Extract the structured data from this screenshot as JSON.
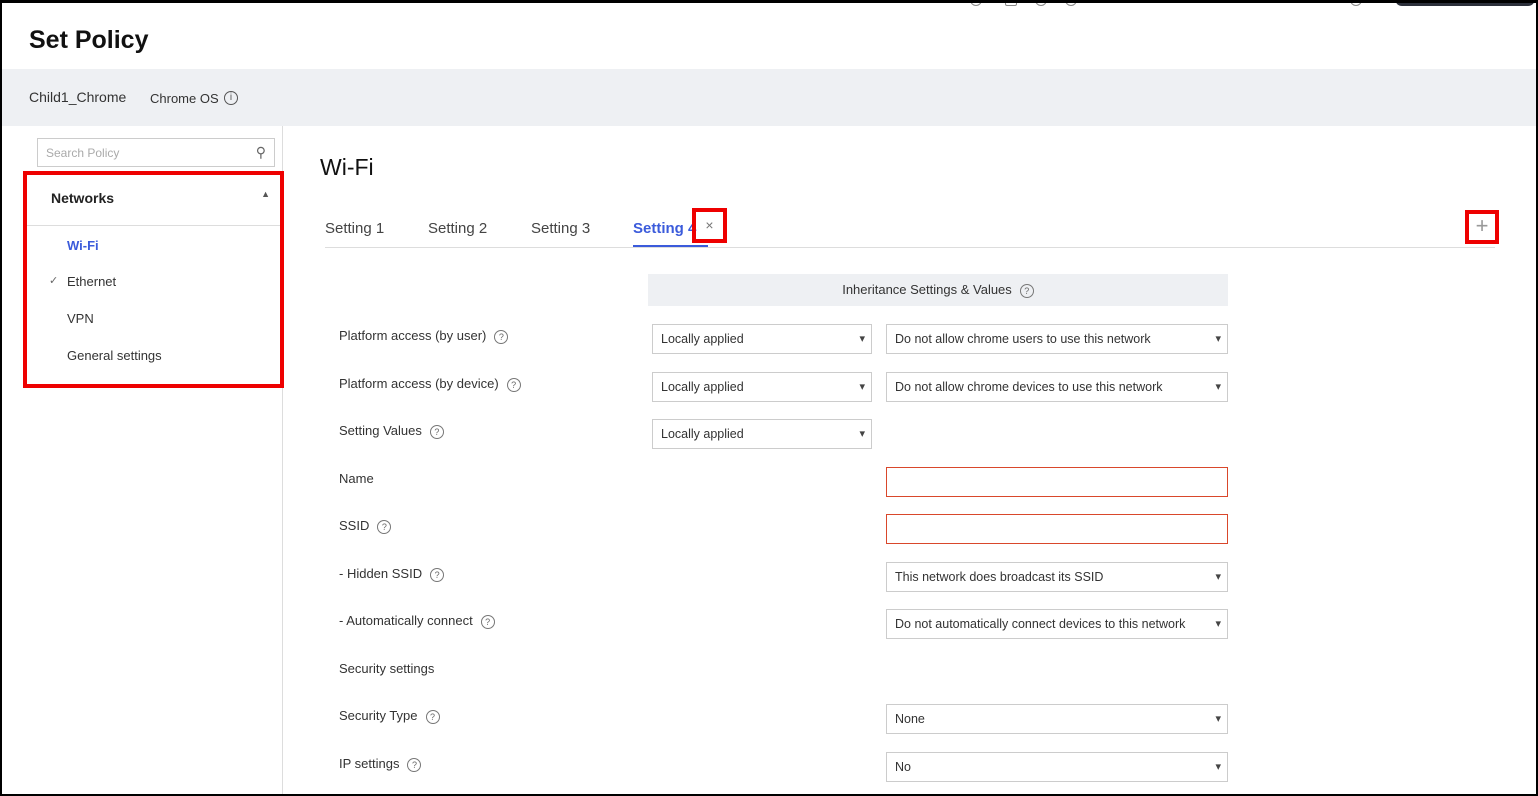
{
  "page_title": "Set Policy",
  "device": {
    "name": "Child1_Chrome",
    "os": "Chrome OS"
  },
  "search": {
    "placeholder": "Search Policy"
  },
  "sidebar": {
    "section": "Networks",
    "items": [
      {
        "label": "Wi-Fi",
        "active": true
      },
      {
        "label": "Ethernet",
        "checked": true
      },
      {
        "label": "VPN"
      },
      {
        "label": "General settings"
      }
    ]
  },
  "main": {
    "title": "Wi-Fi",
    "tabs": [
      {
        "label": "Setting 1"
      },
      {
        "label": "Setting 2"
      },
      {
        "label": "Setting 3"
      },
      {
        "label": "Setting 4",
        "active": true
      }
    ],
    "close_icon": "×",
    "add_icon": "+",
    "inheritance_header": "Inheritance Settings & Values",
    "fields": [
      {
        "label": "Platform access (by user)",
        "inherit": "Locally applied",
        "value": "Do not allow chrome users to use this network"
      },
      {
        "label": "Platform access (by device)",
        "inherit": "Locally applied",
        "value": "Do not allow chrome devices to use this network"
      },
      {
        "label": "Setting Values",
        "inherit": "Locally applied"
      },
      {
        "label": "Name",
        "value": ""
      },
      {
        "label": "SSID",
        "value": ""
      },
      {
        "label": "- Hidden SSID",
        "value": "This network does broadcast its SSID"
      },
      {
        "label": "- Automatically connect",
        "value": "Do not automatically connect devices to this network"
      },
      {
        "label": "Security settings"
      },
      {
        "label": "Security Type",
        "value": "None"
      },
      {
        "label": "IP settings",
        "value": "No"
      }
    ]
  },
  "colors": {
    "accent": "#3b5bdb",
    "highlight": "#ee0000",
    "error_border": "#d9472b"
  }
}
